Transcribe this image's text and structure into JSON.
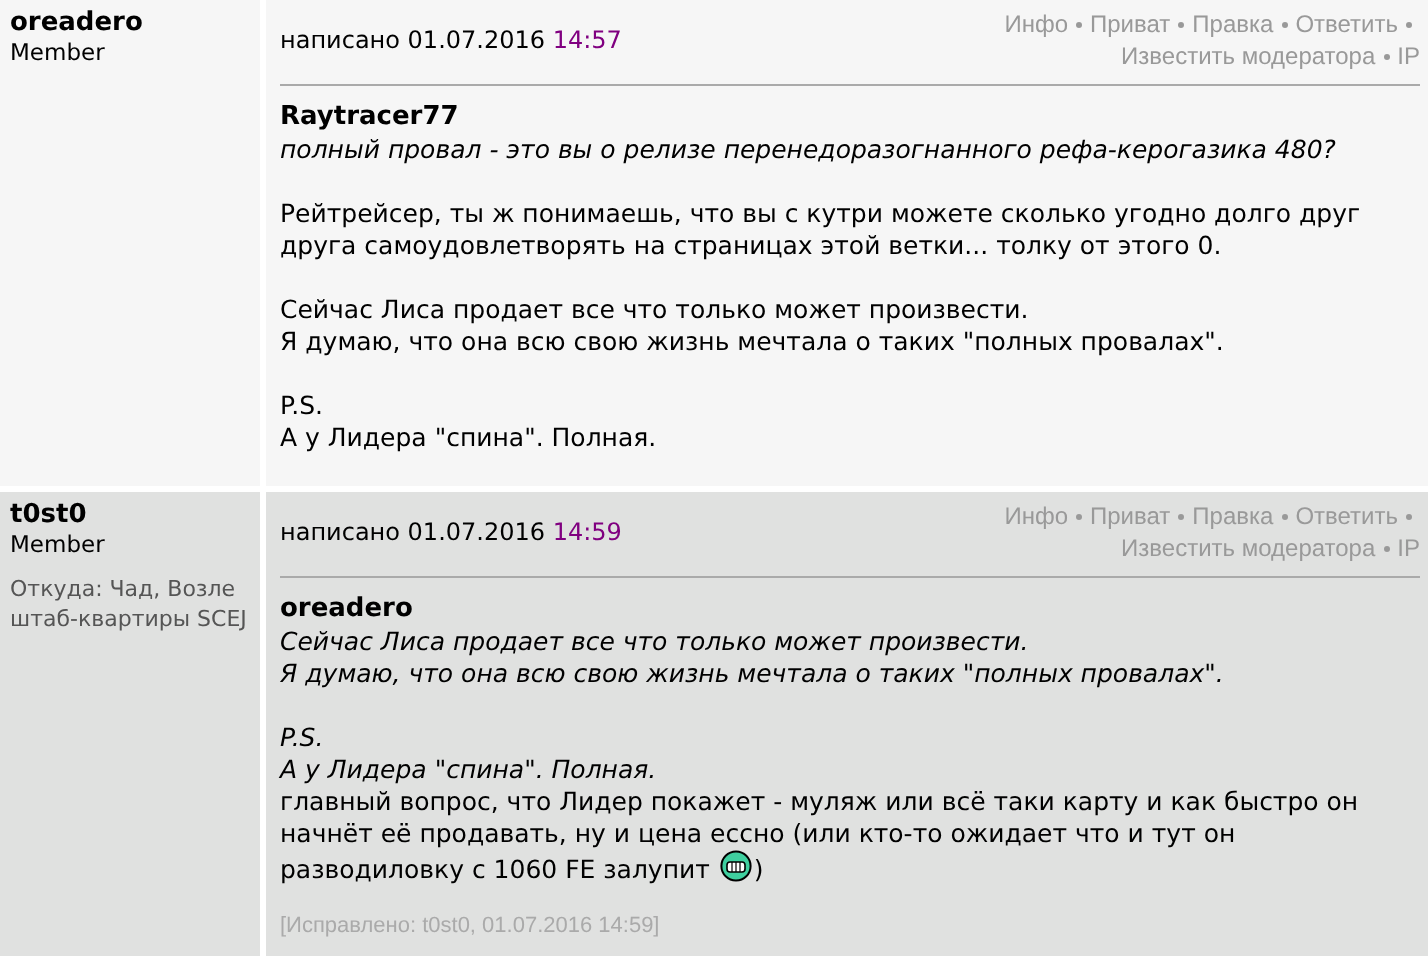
{
  "posts": [
    {
      "author": "oreadero",
      "rank": "Member",
      "date_prefix": "написано 01.07.2016",
      "time": "14:57",
      "actions": [
        "Инфо",
        "Приват",
        "Правка",
        "Ответить",
        "Известить модератора",
        "IP"
      ],
      "quote": {
        "author": "Raytracer77",
        "paragraphs": [
          [
            "полный провал - это вы о релизе перенедоразогнанного рефа-керогазика 480?"
          ]
        ]
      },
      "body": [
        [
          "Рейтрейсер, ты ж понимаешь, что вы с кутри можете сколько угодно долго друг",
          "друга самоудовлетворять на страницах этой ветки... толку от этого 0."
        ],
        [
          "Сейчас Лиса продает все что только может произвести.",
          "Я думаю, что она всю свою жизнь мечтала о таких \"полных провалах\"."
        ],
        [
          "P.S.",
          "А у Лидера \"спина\". Полная."
        ]
      ]
    },
    {
      "author": "t0st0",
      "rank": "Member",
      "location": "Откуда: Чад, Возле штаб-квартиры SCEJ",
      "date_prefix": "написано 01.07.2016",
      "time": "14:59",
      "actions": [
        "Инфо",
        "Приват",
        "Правка",
        "Ответить",
        "Известить модератора",
        "IP"
      ],
      "quote": {
        "author": "oreadero",
        "paragraphs": [
          [
            "Сейчас Лиса продает все что только может произвести.",
            "Я думаю, что она всю свою жизнь мечтала о таких \"полных провалах\"."
          ],
          [
            "P.S.",
            "А у Лидера \"спина\". Полная."
          ]
        ]
      },
      "body": [
        [
          "главный вопрос, что Лидер покажет - муляж или всё таки карту и как быстро он",
          "начнёт её продавать, ну и цена ессно (или кто-то ожидает что и тут он",
          {
            "kind": "smiley",
            "before": "разводиловку с 1060 FE залупит",
            "after": ")"
          }
        ]
      ],
      "edited": "[Исправлено: t0st0, 01.07.2016 14:59]"
    }
  ]
}
